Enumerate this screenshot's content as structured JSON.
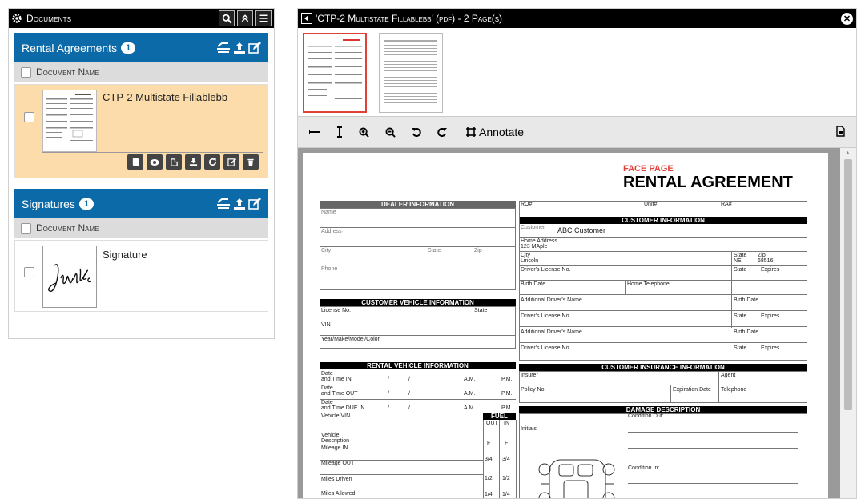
{
  "left_panel": {
    "title": "Documents",
    "rental_section": {
      "title": "Rental Agreements",
      "count": "1",
      "column_header": "Document Name",
      "document": {
        "name": "CTP-2 Multistate Fillablebb"
      }
    },
    "signatures_section": {
      "title": "Signatures",
      "count": "1",
      "column_header": "Document Name",
      "document": {
        "name": "Signature"
      }
    }
  },
  "viewer": {
    "title": "'CTP-2 Multistate Fillablebb' (pdf) - 2 Page(s)",
    "toolbar": {
      "annotate_label": "Annotate"
    }
  },
  "form": {
    "face_page": "FACE PAGE",
    "heading": "RENTAL AGREEMENT",
    "dealer_info": "DEALER INFORMATION",
    "name": "Name",
    "address": "Address",
    "city": "City",
    "state": "State",
    "zip": "Zip",
    "phone": "Phone",
    "ro": "RO#",
    "unit": "Unit#",
    "ra": "RA#",
    "customer_info": "CUSTOMER INFORMATION",
    "customer_label": "Customer",
    "customer_value": "ABC Customer",
    "home_address_label": "Home Address",
    "home_address_value": "123 MAple",
    "city_label": "City",
    "city_value": "Lincoln",
    "state_label": "State",
    "state_value": "NE",
    "zip_label": "Zip",
    "zip_value": "68516",
    "drivers_license": "Driver's License No.",
    "expires": "Expires",
    "birth_date": "Birth Date",
    "home_telephone": "Home Telephone",
    "additional_driver": "Additional Driver's Name",
    "customer_vehicle_info": "CUSTOMER VEHICLE INFORMATION",
    "license_no": "License No.",
    "vin": "VIN",
    "year_make": "Year/Make/Model/Color",
    "rental_vehicle_info": "RENTAL VEHICLE INFORMATION",
    "date": "Date",
    "time_in": "and Time IN",
    "time_out": "and Time OUT",
    "time_due_in": "and Time DUE IN",
    "slash": "/",
    "am": "A.M.",
    "pm": "P.M.",
    "vehicle_vin": "Vehicle VIN",
    "vehicle": "Vehicle",
    "description": "Description",
    "mileage_in": "Mileage IN",
    "mileage_out": "Mileage OUT",
    "miles_driven": "Miles Driven",
    "miles_allowed": "Miles Allowed",
    "fuel": "FUEL",
    "out": "OUT",
    "in": "IN",
    "fuel_levels": [
      "F",
      "3/4",
      "1/2",
      "1/4"
    ],
    "customer_insurance_info": "CUSTOMER INSURANCE INFORMATION",
    "insurer": "Insurer",
    "agent": "Agent",
    "policy_no": "Policy No.",
    "expiration_date": "Expiration Date",
    "telephone": "Telephone",
    "damage_description": "DAMAGE DESCRIPTION",
    "initials": "Initials",
    "condition_out": "Condition Out:",
    "condition_in": "Condition In:"
  }
}
